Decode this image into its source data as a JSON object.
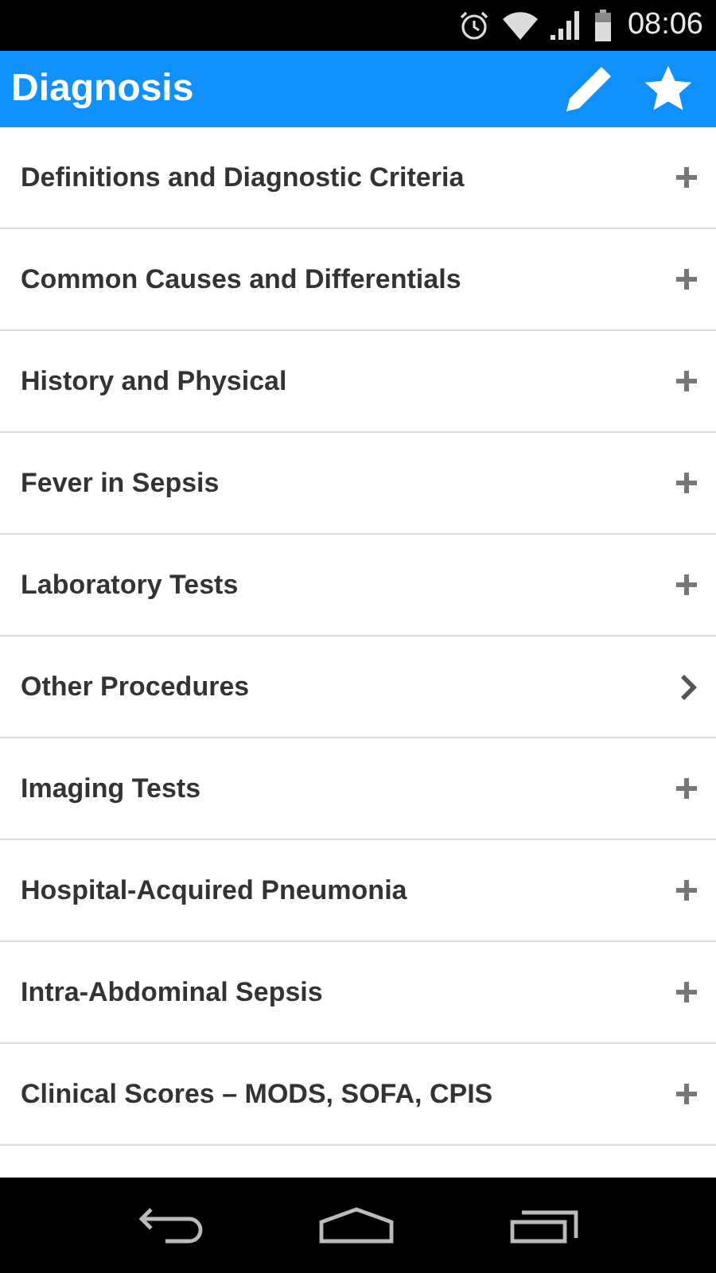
{
  "status_bar": {
    "time": "08:06"
  },
  "header": {
    "title": "Diagnosis"
  },
  "items": [
    {
      "label": "Definitions and Diagnostic Criteria",
      "kind": "expand"
    },
    {
      "label": "Common Causes and Differentials",
      "kind": "expand"
    },
    {
      "label": "History and Physical",
      "kind": "expand"
    },
    {
      "label": "Fever in Sepsis",
      "kind": "expand"
    },
    {
      "label": "Laboratory Tests",
      "kind": "expand"
    },
    {
      "label": "Other Procedures",
      "kind": "link"
    },
    {
      "label": "Imaging Tests",
      "kind": "expand"
    },
    {
      "label": "Hospital-Acquired Pneumonia",
      "kind": "expand"
    },
    {
      "label": "Intra-Abdominal Sepsis",
      "kind": "expand"
    },
    {
      "label": "Clinical Scores – MODS, SOFA, CPIS",
      "kind": "expand"
    }
  ]
}
